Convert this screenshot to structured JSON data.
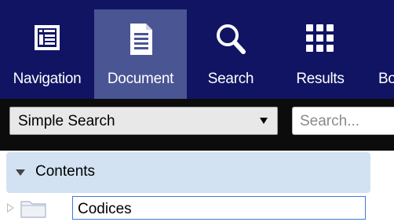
{
  "toolbar": {
    "items": [
      {
        "label": "Navigation",
        "icon": "navigation-icon",
        "active": false
      },
      {
        "label": "Document",
        "icon": "document-icon",
        "active": true
      },
      {
        "label": "Search",
        "icon": "search-icon",
        "active": false
      },
      {
        "label": "Results",
        "icon": "results-grid-icon",
        "active": false
      },
      {
        "label": "Bo",
        "icon": "",
        "active": false
      }
    ],
    "colors": {
      "background": "#111463",
      "active": "#4a5593"
    }
  },
  "search": {
    "mode_selected": "Simple Search",
    "placeholder": "Search..."
  },
  "contents": {
    "header": "Contents",
    "tree": [
      {
        "label": "Codices",
        "icon": "folder-icon",
        "expanded": false
      }
    ]
  }
}
